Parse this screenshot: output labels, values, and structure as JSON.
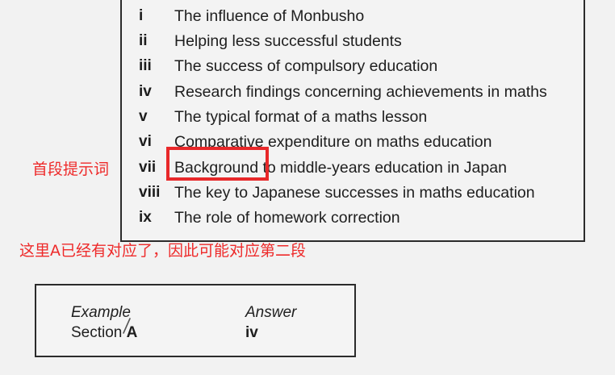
{
  "headings": [
    {
      "numeral": "i",
      "text": "The influence of Monbusho"
    },
    {
      "numeral": "ii",
      "text": "Helping less successful students"
    },
    {
      "numeral": "iii",
      "text": "The success of compulsory education"
    },
    {
      "numeral": "iv",
      "text": "Research findings concerning achievements in maths"
    },
    {
      "numeral": "v",
      "text": "The typical format of a maths lesson"
    },
    {
      "numeral": "vi",
      "text": "Comparative expenditure on maths education"
    },
    {
      "numeral": "vii",
      "highlight": "Background",
      "text": " to middle-years education in Japan"
    },
    {
      "numeral": "viii",
      "text": "The key to Japanese successes in maths education"
    },
    {
      "numeral": "ix",
      "text": "The role of homework correction"
    }
  ],
  "annotations": {
    "first_paragraph_hint": "首段提示词",
    "note": "这里A已经有对应了，因此可能对应第二段"
  },
  "example": {
    "label": "Example",
    "answer_label": "Answer",
    "section_word": "Section",
    "section_letter": "A",
    "answer_value": "iv"
  },
  "colors": {
    "annotation_red": "#ee2a2a",
    "frame_red": "#e8282a"
  }
}
